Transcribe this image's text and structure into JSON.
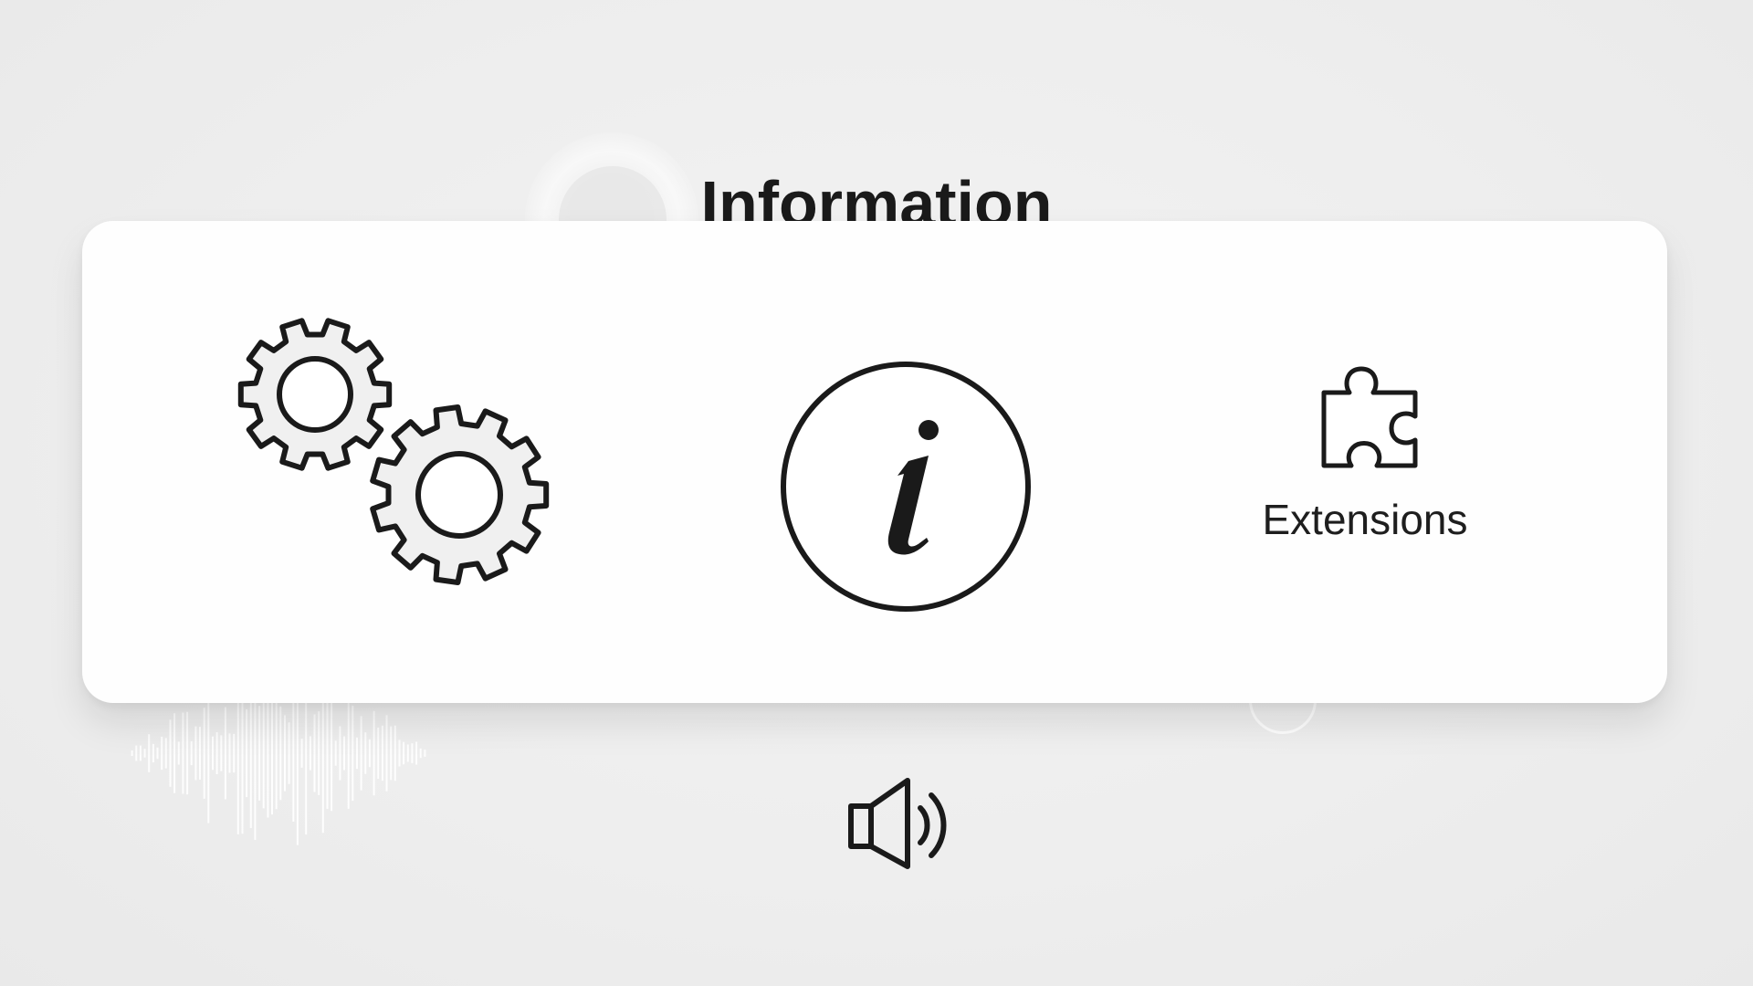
{
  "header": {
    "title": "Information"
  },
  "menu": {
    "items": [
      {
        "id": "settings",
        "icon": "gears-icon",
        "label": ""
      },
      {
        "id": "information",
        "icon": "info-icon",
        "label": ""
      },
      {
        "id": "extensions",
        "icon": "puzzle-piece-icon",
        "label": "Extensions"
      }
    ]
  },
  "audio": {
    "icon": "speaker-icon"
  },
  "colors": {
    "background": "#ededed",
    "card": "#fefefe",
    "icon_stroke": "#1a1a1a",
    "icon_fill": "#f0f0f0",
    "text": "#1a1a1a"
  }
}
